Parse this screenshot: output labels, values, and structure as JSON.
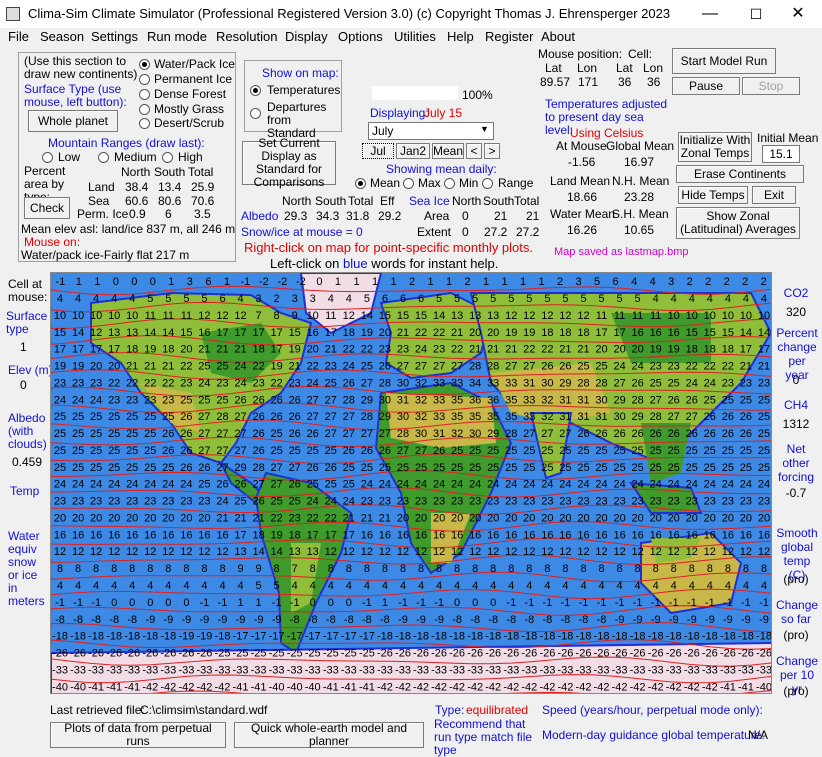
{
  "window": {
    "title": "Clima-Sim Climate Simulator (Professional Registered Version 3.0)    (c) Copyright Thomas J. Ehrensperger 2023",
    "minimize": "—",
    "maximize": "☐",
    "close": "✕"
  },
  "menu": [
    "File",
    "Season",
    "Settings",
    "Run mode",
    "Resolution",
    "Display",
    "Options",
    "Utilities",
    "Help",
    "Register",
    "About"
  ],
  "surface": {
    "instructions": "(Use this section to draw new continents)",
    "surface_type_label": "Surface Type (use mouse, left button):",
    "options": [
      "Water/Pack Ice",
      "Permanent Ice",
      "Dense Forest",
      "Mostly Grass",
      "Desert/Scrub"
    ],
    "selected": 0,
    "whole_planet": "Whole planet",
    "mountain_label": "Mountain Ranges (draw last):",
    "mountain_options": [
      "Low",
      "Medium",
      "High"
    ],
    "area_label": "Percent area by type:",
    "col_north": "North",
    "col_south": "South",
    "col_total": "Total",
    "rows": [
      {
        "label": "Land",
        "north": "38.4",
        "south": "13.4",
        "total": "25.9"
      },
      {
        "label": "Sea",
        "north": "60.6",
        "south": "80.6",
        "total": "70.6"
      },
      {
        "label": "Perm. Ice",
        "north": "0.9",
        "south": "6",
        "total": "3.5"
      }
    ],
    "check": "Check",
    "mean_elev": "Mean elev asl: land/ice  837 m, all  246 m",
    "mouse_on_label": "Mouse on:",
    "mouse_on_value": "Water/pack ice-Fairly flat 217 m"
  },
  "show_on_map": {
    "title": "Show on map:",
    "options": [
      "Temperatures",
      "Departures from Standard"
    ],
    "selected": 0
  },
  "set_standard": "Set Current Display as Standard for Comparisons",
  "slider": {
    "value_label": "100%",
    "fraction": 1.0
  },
  "displaying": {
    "label": "Displaying:",
    "value": "July 15",
    "select": "July"
  },
  "month_buttons": [
    "Jul",
    "Jan2",
    "Mean",
    "<",
    ">"
  ],
  "mean_daily": {
    "title": "Showing mean daily:",
    "options": [
      "Mean",
      "Max",
      "Min",
      "Range"
    ],
    "selected": 0
  },
  "albedo": {
    "header": [
      "North",
      "South",
      "Total",
      "Eff"
    ],
    "label": "Albedo",
    "values": [
      "29.3",
      "34.3",
      "31.8",
      "29.2"
    ],
    "snow_label": "Snow/ice at mouse = 0"
  },
  "sea_ice": {
    "title": "Sea Ice",
    "header": [
      "North",
      "South",
      "Total"
    ],
    "rows": [
      {
        "label": "Area",
        "values": [
          "0",
          "21",
          "21"
        ]
      },
      {
        "label": "Extent",
        "values": [
          "0",
          "27.2",
          "27.2"
        ]
      }
    ]
  },
  "hints": {
    "right_click": "Right-click on map for point-specific monthly plots.",
    "left_click_a": "Left-click on",
    "left_click_b": "blue",
    "left_click_c": "words for instant help."
  },
  "mouse_pos": {
    "title": "Mouse position:",
    "cell_title": "Cell:",
    "lat": "Lat",
    "lon": "Lon",
    "mouse_lat": "89.57",
    "mouse_lon": "171",
    "cell_lat": "36",
    "cell_lon": "36"
  },
  "temps": {
    "adjusted": "Temperatures adjusted to present day sea level:",
    "celsius": "Using Celsius",
    "at_mouse_label": "At Mouse",
    "at_mouse": "-1.56",
    "global_mean_label": "Global Mean",
    "global_mean": "16.97",
    "land_mean_label": "Land Mean",
    "land_mean": "18.66",
    "nh_mean_label": "N.H. Mean",
    "nh_mean": "23.28",
    "water_mean_label": "Water Mean",
    "water_mean": "16.26",
    "sh_mean_label": "S.H. Mean",
    "sh_mean": "10.65"
  },
  "controls": {
    "start": "Start Model Run",
    "pause": "Pause",
    "stop": "Stop",
    "init_zonal": "Initialize  With Zonal Temps",
    "initial_mean_label": "Initial Mean",
    "initial_mean_value": "15.1",
    "erase": "Erase Continents",
    "hide_temps": "Hide Temps",
    "exit": "Exit",
    "show_zonal": "Show Zonal (Latitudinal) Averages",
    "map_saved": "Map saved as lastmap.bmp"
  },
  "left_panel": {
    "cell_at_mouse": "Cell at mouse:",
    "surface_type": "Surface type",
    "surface_val": "1",
    "elev": "Elev (m)",
    "elev_val": "0",
    "albedo": "Albedo (with clouds)",
    "albedo_val": "0.459",
    "temp": "Temp",
    "water": "Water equiv snow or ice in meters"
  },
  "right_panel": {
    "co2": "CO2",
    "co2_val": "320",
    "pct_change": "Percent change per year",
    "pct_val": "0",
    "ch4": "CH4",
    "ch4_val": "1312",
    "net_forcing": "Net other forcing",
    "net_val": "-0.7",
    "smooth": "Smooth global temp (C)",
    "smooth_val": "(pro)",
    "change_sofar": "Change so far",
    "change_sofar_val": "(pro)",
    "change_10": "Change per 10 yr",
    "change_10_val": "(pro)"
  },
  "map_rows": [
    [
      -1,
      1,
      1,
      0,
      0,
      0,
      1,
      3,
      6,
      1,
      -1,
      -2,
      -2,
      -2,
      0,
      1,
      1,
      1,
      1,
      2,
      1,
      1,
      2,
      1,
      1,
      1,
      1,
      2,
      3,
      5,
      6,
      4,
      4,
      3,
      2,
      2,
      2,
      2,
      2
    ],
    [
      4,
      4,
      4,
      4,
      4,
      5,
      5,
      5,
      5,
      6,
      4,
      3,
      2,
      3,
      3,
      4,
      4,
      5,
      6,
      6,
      6,
      5,
      5,
      5,
      5,
      5,
      5,
      5,
      5,
      5,
      5,
      5,
      5,
      4,
      4,
      4,
      4,
      4,
      4,
      4
    ],
    [
      10,
      10,
      10,
      10,
      10,
      11,
      11,
      11,
      12,
      12,
      12,
      7,
      8,
      9,
      10,
      11,
      12,
      14,
      15,
      15,
      15,
      14,
      13,
      13,
      13,
      12,
      12,
      12,
      12,
      12,
      11,
      11,
      11,
      11,
      10,
      10,
      10,
      10,
      10,
      10
    ],
    [
      15,
      14,
      12,
      13,
      13,
      14,
      14,
      15,
      16,
      17,
      17,
      17,
      17,
      15,
      16,
      17,
      18,
      19,
      20,
      21,
      22,
      22,
      21,
      20,
      20,
      19,
      19,
      18,
      18,
      18,
      17,
      17,
      16,
      16,
      16,
      15,
      15,
      15,
      14,
      14
    ],
    [
      17,
      17,
      17,
      17,
      18,
      19,
      18,
      20,
      21,
      21,
      21,
      18,
      17,
      19,
      20,
      21,
      22,
      22,
      23,
      23,
      24,
      23,
      22,
      21,
      21,
      21,
      22,
      22,
      21,
      21,
      20,
      20,
      20,
      19,
      19,
      18,
      18,
      18,
      17,
      17
    ],
    [
      19,
      19,
      20,
      20,
      21,
      21,
      21,
      22,
      25,
      25,
      24,
      22,
      19,
      21,
      22,
      23,
      24,
      25,
      26,
      27,
      27,
      27,
      27,
      28,
      28,
      27,
      27,
      26,
      26,
      25,
      25,
      24,
      24,
      23,
      23,
      22,
      22,
      22,
      21,
      21
    ],
    [
      23,
      23,
      23,
      22,
      22,
      22,
      22,
      23,
      24,
      23,
      24,
      23,
      22,
      23,
      24,
      25,
      26,
      27,
      28,
      30,
      32,
      33,
      33,
      34,
      33,
      33,
      31,
      30,
      29,
      28,
      28,
      27,
      26,
      25,
      25,
      24,
      24,
      23,
      23,
      23
    ],
    [
      24,
      24,
      24,
      23,
      23,
      23,
      23,
      25,
      25,
      25,
      26,
      26,
      26,
      26,
      27,
      27,
      28,
      29,
      30,
      31,
      32,
      33,
      35,
      36,
      36,
      35,
      33,
      32,
      31,
      31,
      30,
      29,
      28,
      27,
      26,
      26,
      25,
      25,
      25,
      25
    ],
    [
      25,
      25,
      25,
      25,
      25,
      25,
      25,
      26,
      27,
      28,
      27,
      26,
      26,
      26,
      27,
      27,
      27,
      28,
      29,
      30,
      32,
      33,
      35,
      35,
      35,
      35,
      33,
      32,
      31,
      31,
      31,
      30,
      29,
      28,
      27,
      27,
      26,
      26,
      26,
      25
    ],
    [
      25,
      25,
      25,
      25,
      25,
      25,
      26,
      26,
      27,
      27,
      27,
      26,
      25,
      26,
      26,
      27,
      27,
      27,
      27,
      28,
      30,
      31,
      32,
      30,
      29,
      28,
      27,
      27,
      27,
      26,
      26,
      26,
      26,
      26,
      26,
      26,
      26,
      26,
      26,
      25
    ],
    [
      25,
      25,
      25,
      25,
      25,
      25,
      26,
      26,
      27,
      27,
      27,
      26,
      25,
      25,
      25,
      25,
      26,
      26,
      26,
      27,
      27,
      26,
      25,
      25,
      25,
      25,
      25,
      25,
      25,
      25,
      25,
      25,
      25,
      25,
      25,
      25,
      25,
      25,
      25,
      25
    ],
    [
      25,
      25,
      25,
      25,
      25,
      25,
      25,
      26,
      26,
      27,
      29,
      28,
      27,
      27,
      26,
      26,
      25,
      25,
      25,
      25,
      25,
      25,
      25,
      25,
      25,
      25,
      25,
      25,
      25,
      25,
      25,
      25,
      25,
      25,
      25,
      25,
      25,
      25,
      25,
      25
    ],
    [
      24,
      24,
      24,
      24,
      24,
      24,
      24,
      24,
      25,
      26,
      26,
      27,
      27,
      26,
      25,
      25,
      25,
      24,
      24,
      24,
      24,
      24,
      24,
      24,
      24,
      24,
      24,
      24,
      24,
      24,
      24,
      24,
      24,
      24,
      24,
      24,
      24,
      24,
      24,
      24
    ],
    [
      23,
      23,
      23,
      23,
      23,
      23,
      23,
      23,
      23,
      24,
      25,
      26,
      25,
      25,
      24,
      24,
      24,
      23,
      23,
      23,
      23,
      23,
      23,
      23,
      23,
      23,
      23,
      23,
      23,
      23,
      23,
      23,
      23,
      23,
      23,
      23,
      23,
      23,
      23,
      23
    ],
    [
      20,
      20,
      20,
      20,
      20,
      20,
      20,
      20,
      20,
      21,
      21,
      21,
      22,
      23,
      22,
      22,
      21,
      21,
      21,
      20,
      20,
      20,
      20,
      20,
      20,
      20,
      20,
      20,
      20,
      20,
      20,
      20,
      20,
      20,
      20,
      20,
      20,
      20,
      20,
      20
    ],
    [
      16,
      16,
      16,
      16,
      16,
      16,
      16,
      16,
      16,
      16,
      17,
      18,
      19,
      18,
      17,
      17,
      17,
      16,
      16,
      16,
      16,
      16,
      16,
      16,
      16,
      16,
      16,
      16,
      16,
      16,
      16,
      16,
      16,
      16,
      16,
      16,
      16,
      16,
      16,
      16
    ],
    [
      12,
      12,
      12,
      12,
      12,
      12,
      12,
      12,
      12,
      12,
      13,
      14,
      14,
      13,
      13,
      12,
      12,
      12,
      12,
      12,
      12,
      12,
      12,
      12,
      12,
      12,
      12,
      12,
      12,
      12,
      12,
      12,
      12,
      12,
      12,
      12,
      12,
      12,
      12,
      12
    ],
    [
      8,
      8,
      8,
      8,
      8,
      8,
      8,
      8,
      8,
      8,
      9,
      9,
      8,
      7,
      8,
      8,
      8,
      8,
      8,
      8,
      8,
      8,
      8,
      8,
      8,
      8,
      8,
      8,
      8,
      8,
      8,
      8,
      8,
      8,
      8,
      8,
      8,
      8,
      8,
      8
    ],
    [
      4,
      4,
      4,
      4,
      4,
      4,
      4,
      4,
      4,
      4,
      4,
      5,
      5,
      4,
      4,
      4,
      4,
      4,
      4,
      4,
      4,
      4,
      4,
      4,
      4,
      4,
      4,
      4,
      4,
      4,
      4,
      4,
      4,
      4,
      4,
      4,
      4,
      4,
      4,
      4
    ],
    [
      -1,
      -1,
      -1,
      0,
      0,
      0,
      0,
      0,
      -1,
      -1,
      1,
      1,
      -1,
      -1,
      0,
      0,
      0,
      -1,
      1,
      -1,
      -1,
      -1,
      0,
      0,
      0,
      -1,
      -1,
      -1,
      -1,
      -1,
      -1,
      -1,
      -1,
      -1,
      -1,
      -1,
      -1,
      -1,
      -1,
      -1
    ],
    [
      -8,
      -8,
      -8,
      -8,
      -8,
      -9,
      -9,
      -9,
      -9,
      -9,
      -9,
      -9,
      -9,
      -8,
      -8,
      -8,
      -8,
      -8,
      -8,
      -9,
      -9,
      -9,
      -8,
      -8,
      -8,
      -8,
      -8,
      -8,
      -8,
      -8,
      -8,
      -9,
      -9,
      -9,
      -9,
      -9,
      -9,
      -9,
      -9,
      -9
    ],
    [
      -18,
      -18,
      -18,
      -18,
      -18,
      -18,
      -18,
      -19,
      -19,
      -18,
      -17,
      -17,
      -17,
      -17,
      -17,
      -17,
      -17,
      -17,
      -18,
      -18,
      -18,
      -18,
      -18,
      -18,
      -18,
      -18,
      -18,
      -18,
      -18,
      -18,
      -18,
      -18,
      -18,
      -18,
      -18,
      -18,
      -18,
      -18,
      -18,
      -18
    ],
    [
      -26,
      -26,
      -26,
      -26,
      -26,
      -26,
      -26,
      -26,
      -26,
      -25,
      -25,
      -25,
      -25,
      -25,
      -25,
      -25,
      -25,
      -25,
      -26,
      -26,
      -26,
      -26,
      -26,
      -26,
      -26,
      -26,
      -26,
      -26,
      -26,
      -26,
      -26,
      -26,
      -26,
      -26,
      -26,
      -26,
      -26,
      -26,
      -26,
      -26
    ],
    [
      -33,
      -33,
      -33,
      -33,
      -33,
      -33,
      -33,
      -33,
      -33,
      -33,
      -33,
      -33,
      -33,
      -33,
      -33,
      -33,
      -33,
      -33,
      -33,
      -33,
      -33,
      -33,
      -33,
      -33,
      -33,
      -33,
      -33,
      -33,
      -33,
      -33,
      -33,
      -33,
      -33,
      -33,
      -33,
      -33,
      -33,
      -33,
      -33,
      -33
    ],
    [
      -40,
      -40,
      -41,
      -41,
      -41,
      -42,
      -42,
      -42,
      -42,
      -42,
      -41,
      -41,
      -40,
      -40,
      -40,
      -41,
      -41,
      -41,
      -42,
      -42,
      -42,
      -42,
      -42,
      -42,
      -42,
      -42,
      -42,
      -42,
      -42,
      -42,
      -42,
      -42,
      -42,
      -42,
      -42,
      -42,
      -42,
      -41,
      -41,
      -40
    ]
  ],
  "bottom": {
    "last_file_label": "Last retrieved file:",
    "last_file": "C:\\climsim\\standard.wdf",
    "type_label": "Type:",
    "type_value": "equilibrated",
    "recommend": "Recommend that run type match file type",
    "speed": "Speed (years/hour, perpetual mode only):",
    "plots": "Plots of data from perpetual runs",
    "quick": "Quick whole-earth model and planner",
    "guidance_label": "Modern-day guidance global temperature:",
    "guidance_value": "N/A"
  },
  "colors": {
    "ocean": "#3d8ae6",
    "desert": "#c8b84a",
    "grass": "#8fbf3a",
    "forest": "#3e9b2c",
    "ice": "#f2dce6",
    "border": "#1f2fd4",
    "isoline": "#e02020"
  }
}
